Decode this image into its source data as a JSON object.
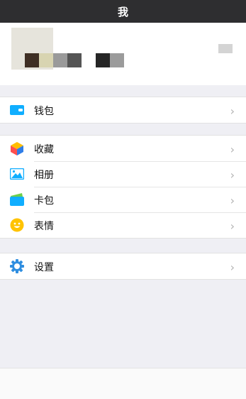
{
  "header": {
    "title": "我"
  },
  "profile": {
    "swatch_colors": [
      "#3f2f24",
      "#d8d4b1",
      "#9a9a9a",
      "#555555",
      "#ffffff",
      "#262626",
      "#9b9b9b"
    ]
  },
  "menu": {
    "wallet": {
      "label": "钱包",
      "icon": "wallet-icon"
    },
    "favorites": {
      "label": "收藏",
      "icon": "cube-icon"
    },
    "album": {
      "label": "相册",
      "icon": "photo-icon"
    },
    "cards": {
      "label": "卡包",
      "icon": "card-icon"
    },
    "stickers": {
      "label": "表情",
      "icon": "smiley-icon"
    },
    "settings": {
      "label": "设置",
      "icon": "gear-icon"
    }
  },
  "chevron": "›",
  "colors": {
    "accent": "#10aeff",
    "titlebar": "#2e2e30",
    "background": "#efeff4"
  }
}
